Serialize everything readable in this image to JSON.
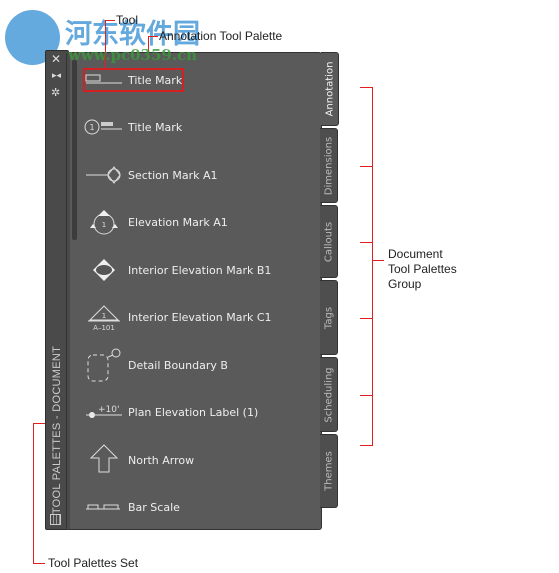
{
  "watermark": {
    "brand": "河东软件园",
    "url": "www.pc0359.cn"
  },
  "callouts": {
    "tool": "Tool",
    "palette": "Annotation Tool Palette",
    "group": [
      "Document",
      "Tool Palettes",
      "Group"
    ],
    "set": "Tool Palettes Set"
  },
  "strip": {
    "title": "TOOL PALETTES - DOCUMENT",
    "icons": [
      "close-icon",
      "auto-hide-icon",
      "properties-icon",
      "palette-set-icon"
    ]
  },
  "items": [
    {
      "label": "Title Mark",
      "icon": "title-mark-icon"
    },
    {
      "label": "Title Mark",
      "icon": "title-mark-numbered-icon"
    },
    {
      "label": "Section Mark A1",
      "icon": "section-mark-icon"
    },
    {
      "label": "Elevation Mark A1",
      "icon": "elevation-mark-icon"
    },
    {
      "label": "Interior Elevation Mark B1",
      "icon": "interior-elevation-b-icon"
    },
    {
      "label": "Interior Elevation Mark C1",
      "icon": "interior-elevation-c-icon"
    },
    {
      "label": "Detail Boundary B",
      "icon": "detail-boundary-icon"
    },
    {
      "label": "Plan Elevation Label (1)",
      "icon": "plan-elevation-icon"
    },
    {
      "label": "North Arrow",
      "icon": "north-arrow-icon"
    },
    {
      "label": "Bar Scale",
      "icon": "bar-scale-icon"
    }
  ],
  "icon_text": {
    "one": "1",
    "ref": "A–101",
    "elev": "+10'"
  },
  "tabs": [
    {
      "label": "Annotation",
      "active": true
    },
    {
      "label": "Dimensions"
    },
    {
      "label": "Callouts"
    },
    {
      "label": "Tags"
    },
    {
      "label": "Scheduling"
    },
    {
      "label": "Themes"
    }
  ],
  "colors": {
    "panel": "#5a5a5a",
    "highlight": "#e02020"
  }
}
